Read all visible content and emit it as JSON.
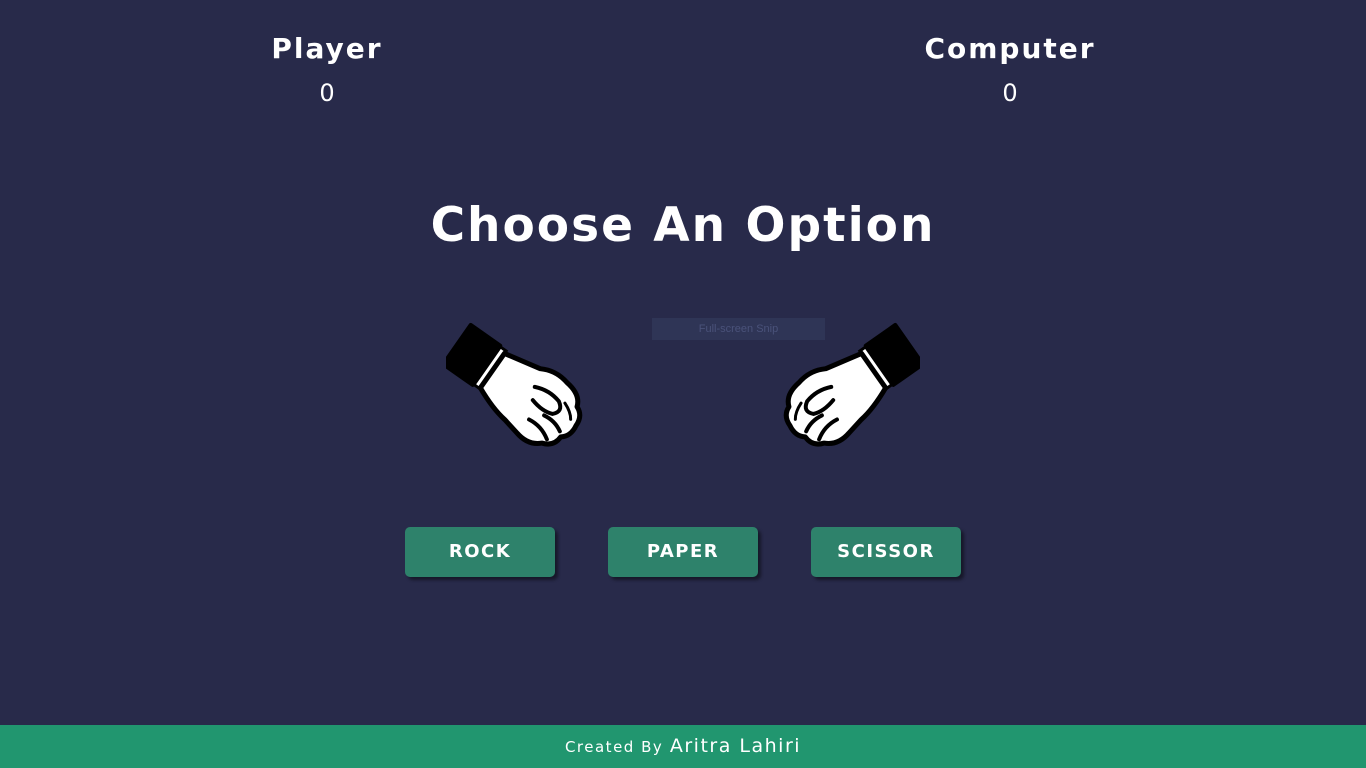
{
  "scoreboard": {
    "player": {
      "title": "Player",
      "score": "0"
    },
    "computer": {
      "title": "Computer",
      "score": "0"
    }
  },
  "headline": "Choose An Option",
  "overlay": {
    "snip_tooltip": "Full-screen Snip"
  },
  "hands": {
    "player_hand": "fist-icon",
    "computer_hand": "fist-icon"
  },
  "choices": {
    "rock": "ROCK",
    "paper": "PAPER",
    "scissor": "SCISSOR"
  },
  "footer": {
    "prefix": "Created By",
    "author": "Aritra Lahiri"
  },
  "colors": {
    "background": "#282a4a",
    "button": "#2e826b",
    "footer": "#21966f",
    "text": "#ffffff"
  }
}
